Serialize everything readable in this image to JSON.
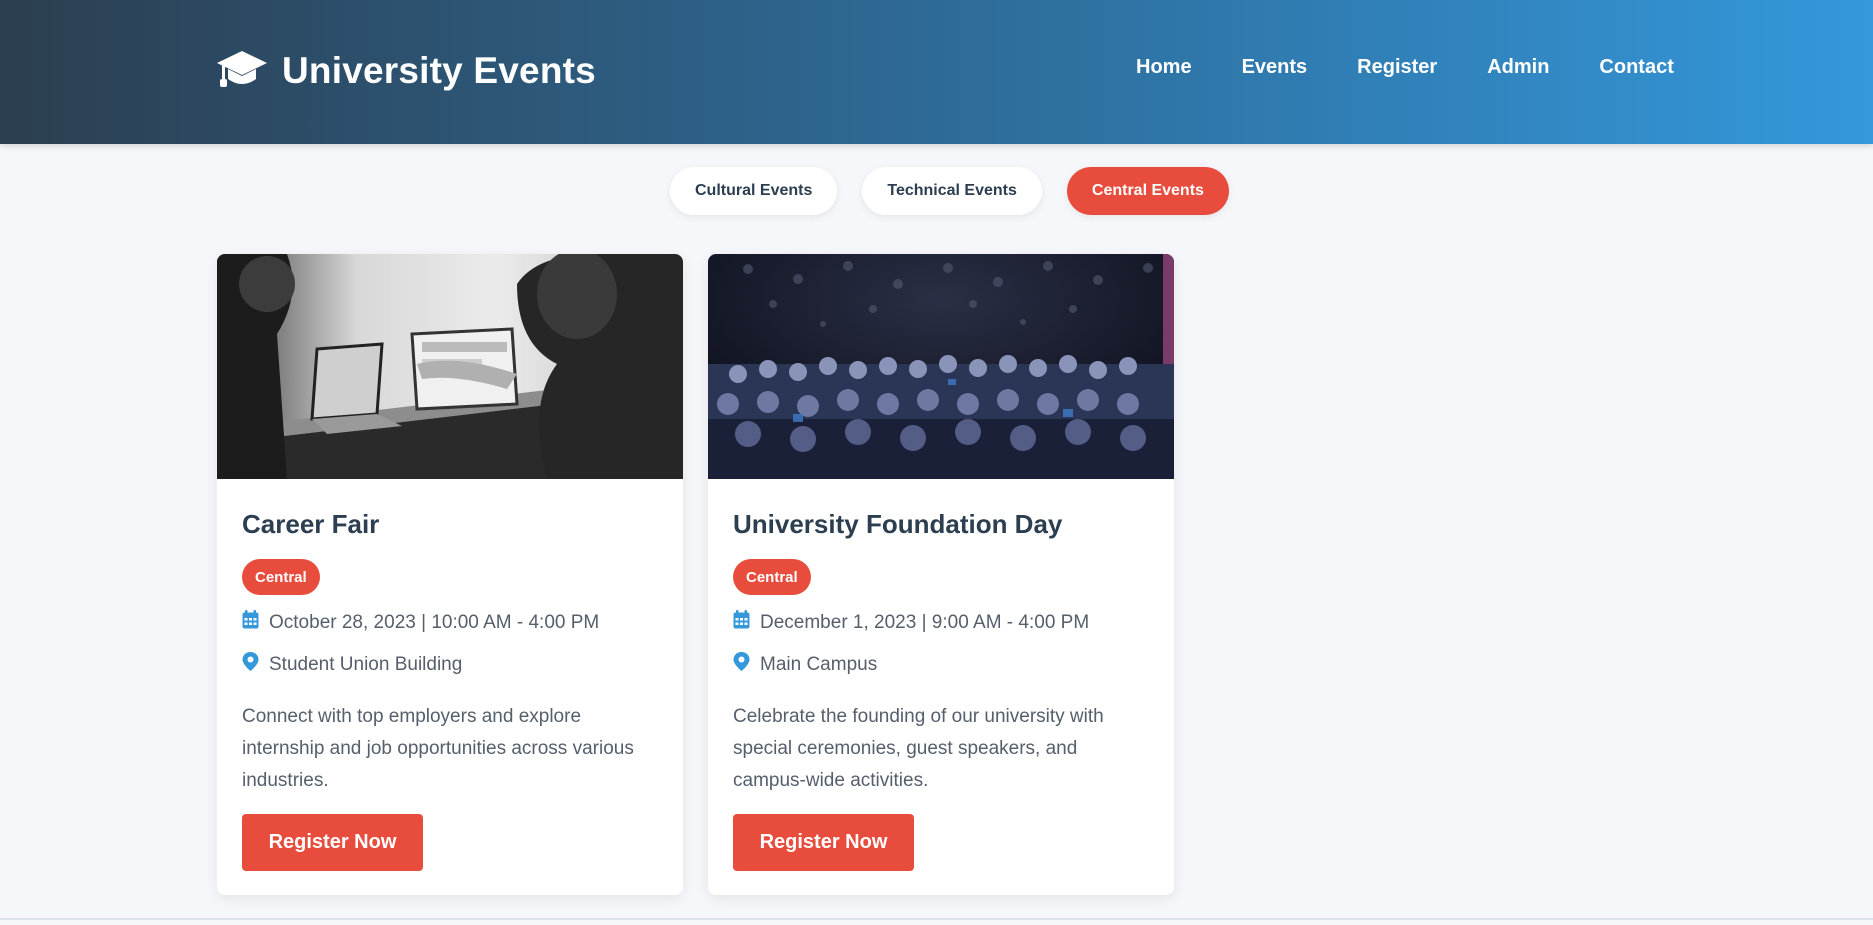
{
  "header": {
    "logo_icon": "graduation-cap-icon",
    "title": "University Events",
    "nav": [
      "Home",
      "Events",
      "Register",
      "Admin",
      "Contact"
    ]
  },
  "filters": {
    "items": [
      "Cultural Events",
      "Technical Events",
      "Central Events"
    ],
    "active": "Central Events"
  },
  "events": [
    {
      "title": "Career Fair",
      "category": "Central",
      "date": "October 28, 2023 | 10:00 AM - 4:00 PM",
      "location": "Student Union Building",
      "description": "Connect with top employers and explore internship and job opportunities across various industries.",
      "button": "Register Now"
    },
    {
      "title": "University Foundation Day",
      "category": "Central",
      "date": "December 1, 2023 | 9:00 AM - 4:00 PM",
      "location": "Main Campus",
      "description": "Celebrate the founding of our university with special ceremonies, guest speakers, and campus-wide activities.",
      "button": "Register Now"
    }
  ],
  "colors": {
    "accent": "#e74c3c",
    "header_start": "#2c3e50",
    "header_end": "#3498db",
    "icon": "#3498db"
  }
}
